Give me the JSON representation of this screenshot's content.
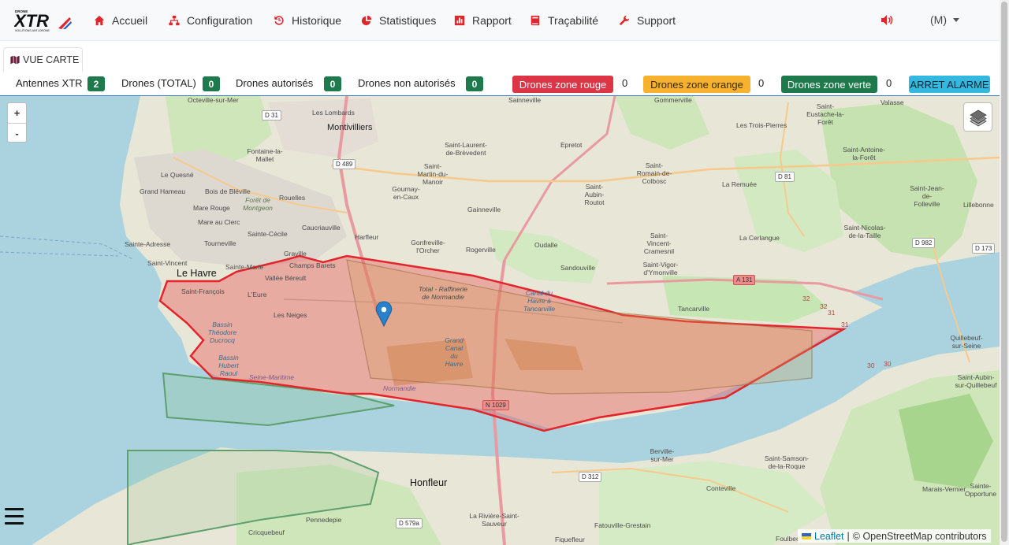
{
  "brand": {
    "logo_text": "XTR",
    "logo_sub": "SOLUTIONS ANTI-DRONE",
    "logo_top": "DRONE"
  },
  "nav": [
    {
      "label": "Accueil",
      "icon": "home-icon"
    },
    {
      "label": "Configuration",
      "icon": "sitemap-icon"
    },
    {
      "label": "Historique",
      "icon": "history-icon"
    },
    {
      "label": "Statistiques",
      "icon": "pie-chart-icon"
    },
    {
      "label": "Rapport",
      "icon": "bar-chart-icon"
    },
    {
      "label": "Traçabilité",
      "icon": "book-icon"
    },
    {
      "label": "Support",
      "icon": "wrench-icon"
    }
  ],
  "user": {
    "label": "(M)"
  },
  "tab": {
    "label": "VUE CARTE",
    "icon": "map-icon"
  },
  "status": {
    "antennes_label": "Antennes XTR",
    "antennes_value": "2",
    "drones_total_label": "Drones (TOTAL)",
    "drones_total_value": "0",
    "drones_autorises_label": "Drones autorisés",
    "drones_autorises_value": "0",
    "drones_non_autorises_label": "Drones non autorisés",
    "drones_non_autorises_value": "0",
    "zone_rouge_label": "Drones zone rouge",
    "zone_rouge_value": "0",
    "zone_orange_label": "Drones zone orange",
    "zone_orange_value": "0",
    "zone_verte_label": "Drones zone verte",
    "zone_verte_value": "0",
    "alarm_label": "ARRET ALARME"
  },
  "map": {
    "zoom_in": "+",
    "zoom_out": "-",
    "attribution_leaflet": "Leaflet",
    "attribution_osm": "© OpenStreetMap contributors",
    "places": {
      "le_havre": "Le Havre",
      "honfleur": "Honfleur",
      "montivilliers": "Montivilliers",
      "harfleur": "Harfleur",
      "gonfreville": "Gonfreville-l'Orcher",
      "rogerville": "Rogerville",
      "oudalle": "Oudalle",
      "sandouville": "Sandouville",
      "tancarville": "Tancarville",
      "st_vincent_cramesnil": "Saint-Vincent-Cramesnil",
      "la_cerlangue": "La Cerlangue",
      "st_vigor": "Saint-Vigor-d'Ymonville",
      "epretot": "Epretot",
      "st_romain": "Saint-Romain-de-Colbosc",
      "st_aubin_routot": "Saint-Aubin-Routot",
      "la_remuee": "La Remuée",
      "gainneville": "Gainneville",
      "gournay": "Gournay-en-Caux",
      "st_martin": "Saint-Martin-du-Manoir",
      "st_laurent": "Saint-Laurent-de-Brèvedent",
      "les_lombards": "Les Lombards",
      "fontaine": "Fontaine-la-Mallet",
      "le_quesne": "Le Quesné",
      "grand_hameau": "Grand Hameau",
      "bois_bleville": "Bois de Bléville",
      "rouelles": "Rouelles",
      "mare_rouge": "Mare Rouge",
      "mare_clerc": "Mare au Clerc",
      "caucriauville": "Caucriauville",
      "sainte_adresse": "Sainte-Adresse",
      "tourneville": "Tourneville",
      "sainte_cecile": "Sainte-Cécile",
      "saint_vincent": "Saint-Vincent",
      "sainte_marie": "Sainte-Marie",
      "graville": "Graville",
      "champs_barets": "Champs Barets",
      "vallee_bereult": "Vallée Béreult",
      "saint_francois": "Saint-François",
      "l_eure": "L'Eure",
      "les_neiges": "Les Neiges",
      "total_raffinerie": "Total - Raffinerie de Normandie",
      "canal_havre": "Canal du Havre à Tancarville",
      "grand_canal": "Grand Canal du Havre",
      "bassin_theodore": "Bassin Théodore Ducrocq",
      "bassin_hubert": "Bassin Hubert Raoul",
      "seine_maritime": "Seine-Maritime",
      "normandie": "Normandie",
      "octeville": "Octeville-sur-Mer",
      "sainneville": "Sainneville",
      "gommerville": "Gommerville",
      "st_eustache": "Saint-Eustache-la-Forêt",
      "valasse": "Valasse",
      "trois_pierres": "Les Trois-Pierres",
      "st_antoine": "Saint-Antoine-la-Forêt",
      "st_jean_folleville": "Saint-Jean-de-Folleville",
      "lillebonne": "Lillebonne",
      "st_nicolas": "Saint-Nicolas-de-la-Taille",
      "quillebeuf": "Quillebeuf-sur-Seine",
      "st_aubin_quillebeuf": "Saint-Aubin-sur-Quillebeuf",
      "st_opportune": "Sainte-Opportune",
      "marais_vernier": "Marais-Vernier",
      "st_samson": "Saint-Samson-de-la-Roque",
      "berville": "Berville-sur-Mer",
      "conteville": "Conteville",
      "foulbec": "Foulbec",
      "fatouville": "Fatouville-Grestain",
      "fiquefleur": "Fiquefleur",
      "la_riviere": "La Rivière-Saint-Sauveur",
      "pennedepie": "Pennedepie",
      "cricquebeuf": "Cricquebeuf",
      "foret_montgeon": "Forêt de Montgeon"
    },
    "roads": {
      "d31": "D 31",
      "d489": "D 489",
      "d81": "D 81",
      "d982": "D 982",
      "d173": "D 173",
      "a131": "A 131",
      "n1029": "N 1029",
      "d312": "D 312",
      "d579a": "D 579a",
      "r31a": "31",
      "r31b": "31",
      "r32a": "32",
      "r32b": "32",
      "r30a": "30",
      "r30b": "30"
    }
  }
}
